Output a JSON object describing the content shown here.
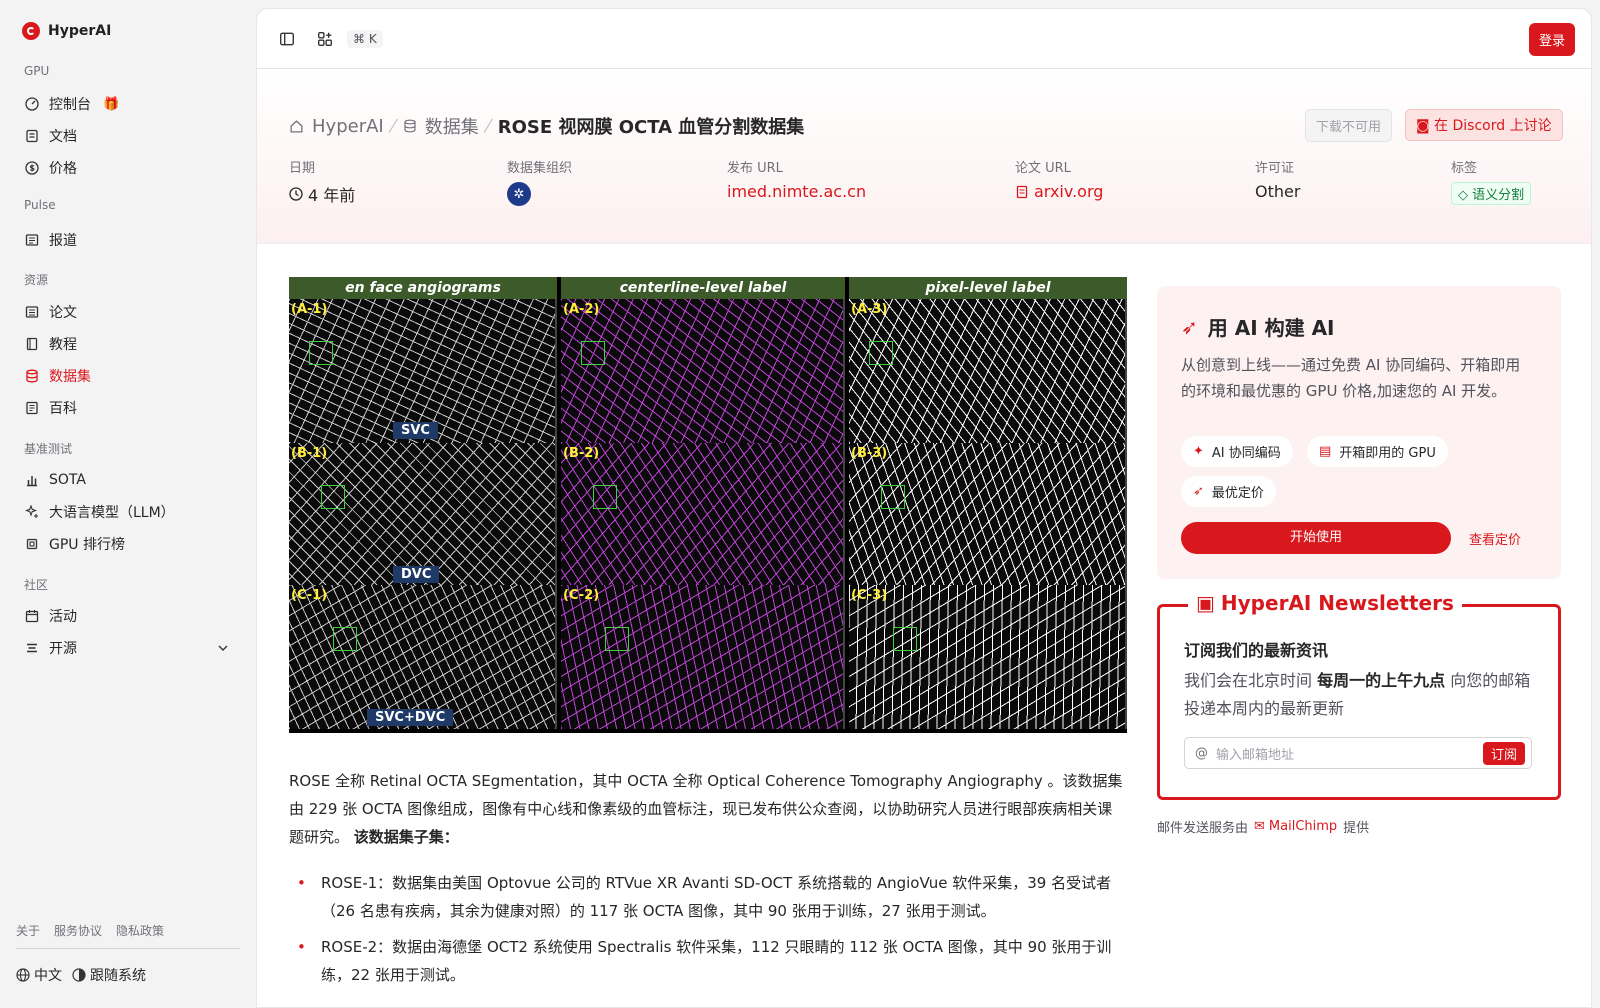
{
  "brand": {
    "name": "HyperAI"
  },
  "sidebar": {
    "sections": [
      {
        "label": "GPU"
      },
      {
        "label": "Pulse"
      },
      {
        "label": "资源"
      },
      {
        "label": "基准测试"
      },
      {
        "label": "社区"
      }
    ],
    "items": [
      {
        "label": "控制台",
        "icon": "dashboard-icon"
      },
      {
        "label": "文档",
        "icon": "document-icon"
      },
      {
        "label": "价格",
        "icon": "dollar-icon"
      },
      {
        "label": "报道",
        "icon": "newspaper-icon"
      },
      {
        "label": "论文",
        "icon": "paper-icon"
      },
      {
        "label": "教程",
        "icon": "book-icon"
      },
      {
        "label": "数据集",
        "icon": "database-icon"
      },
      {
        "label": "百科",
        "icon": "encyclopedia-icon"
      },
      {
        "label": "SOTA",
        "icon": "bar-chart-icon"
      },
      {
        "label": "大语言模型（LLM）",
        "icon": "sparkle-icon"
      },
      {
        "label": "GPU 排行榜",
        "icon": "cpu-icon"
      },
      {
        "label": "活动",
        "icon": "calendar-icon"
      },
      {
        "label": "开源",
        "icon": "list-icon"
      }
    ],
    "footer_links": [
      "关于",
      "服务协议",
      "隐私政策"
    ],
    "language": "中文",
    "theme": "跟随系统"
  },
  "topbar": {
    "shortcut": "⌘ K",
    "login": "登录"
  },
  "breadcrumb": {
    "home": "HyperAI",
    "section": "数据集",
    "current": "ROSE 视网膜 OCTA 血管分割数据集"
  },
  "actions": {
    "download": "下载不可用",
    "discord": "在 Discord 上讨论"
  },
  "meta": {
    "date_label": "日期",
    "date_value": "4 年前",
    "org_label": "数据集组织",
    "release_label": "发布 URL",
    "release_value": "imed.nimte.ac.cn",
    "paper_label": "论文 URL",
    "paper_value": "arxiv.org",
    "license_label": "许可证",
    "license_value": "Other",
    "tags_label": "标签",
    "tag_value": "语义分割"
  },
  "figure": {
    "headers": [
      "en face angiograms",
      "centerline-level label",
      "pixel-level label"
    ],
    "labels": [
      "(A-1)",
      "(A-2)",
      "(A-3)",
      "(B-1)",
      "(B-2)",
      "(B-3)",
      "(C-1)",
      "(C-2)",
      "(C-3)"
    ],
    "row_badges": [
      "SVC",
      "DVC",
      "SVC+DVC"
    ]
  },
  "content": {
    "intro": "ROSE 全称 Retinal OCTA SEgmentation，其中 OCTA 全称 Optical Coherence Tomography Angiography 。该数据集由 229 张 OCTA 图像组成，图像有中心线和像素级的血管标注，现已发布供公众查阅，以协助研究人员进行眼部疾病相关课题研究。",
    "subsets_title": "该数据集子集：",
    "bullets": [
      "ROSE-1：数据集由美国 Optovue 公司的 RTVue XR Avanti SD-OCT 系统搭载的 AngioVue 软件采集，39 名受试者（26 名患有疾病，其余为健康对照）的 117 张 OCTA 图像，其中 90 张用于训练，27 张用于测试。",
      "ROSE-2：数据由海德堡 OCT2 系统使用 Spectralis 软件采集，112 只眼睛的 112 张 OCTA 图像，其中 90 张用于训练，22 张用于测试。"
    ]
  },
  "promo": {
    "title": "用 AI 构建 AI",
    "desc": "从创意到上线——通过免费 AI 协同编码、开箱即用的环境和最优惠的 GPU 价格,加速您的 AI 开发。",
    "pills": [
      "AI 协同编码",
      "开箱即用的 GPU",
      "最优定价"
    ],
    "start": "开始使用",
    "pricing": "查看定价"
  },
  "newsletter": {
    "title": "HyperAI Newsletters",
    "subtitle": "订阅我们的最新资讯",
    "desc_pre": "我们会在北京时间",
    "desc_bold": "每周一的上午九点",
    "desc_post": "向您的邮箱投递本周内的最新更新",
    "placeholder": "输入邮箱地址",
    "submit": "订阅"
  },
  "mail": {
    "pre": "邮件发送服务由",
    "brand": "MailChimp",
    "post": "提供"
  },
  "colors": {
    "accent": "#d9181e",
    "sidebar_bg": "#f3f3f3"
  }
}
